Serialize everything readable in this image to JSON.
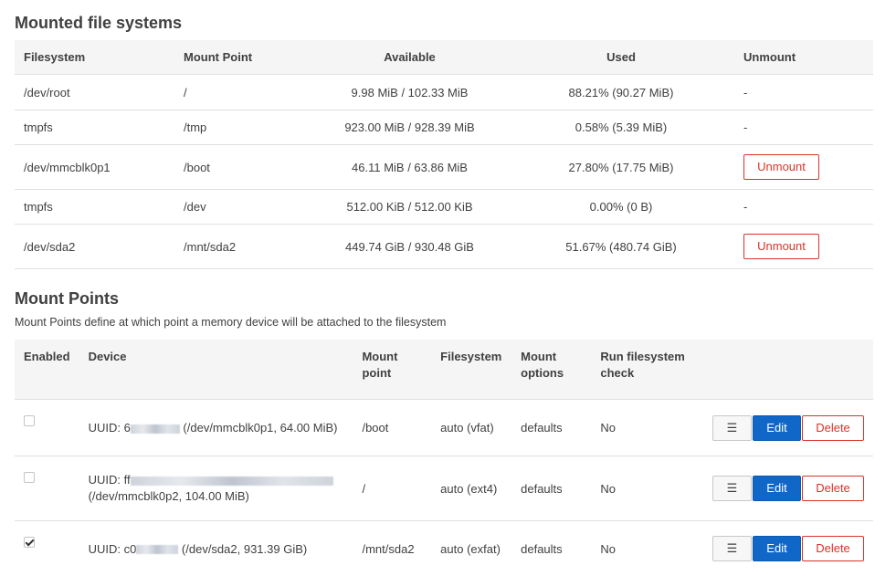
{
  "mounted": {
    "title": "Mounted file systems",
    "headers": {
      "filesystem": "Filesystem",
      "mount_point": "Mount Point",
      "available": "Available",
      "used": "Used",
      "unmount": "Unmount"
    },
    "rows": [
      {
        "fs": "/dev/root",
        "mp": "/",
        "avail": "9.98 MiB / 102.33 MiB",
        "used": "88.21% (90.27 MiB)",
        "action": "-"
      },
      {
        "fs": "tmpfs",
        "mp": "/tmp",
        "avail": "923.00 MiB / 928.39 MiB",
        "used": "0.58% (5.39 MiB)",
        "action": "-"
      },
      {
        "fs": "/dev/mmcblk0p1",
        "mp": "/boot",
        "avail": "46.11 MiB / 63.86 MiB",
        "used": "27.80% (17.75 MiB)",
        "action": "Unmount"
      },
      {
        "fs": "tmpfs",
        "mp": "/dev",
        "avail": "512.00 KiB / 512.00 KiB",
        "used": "0.00% (0 B)",
        "action": "-"
      },
      {
        "fs": "/dev/sda2",
        "mp": "/mnt/sda2",
        "avail": "449.74 GiB / 930.48 GiB",
        "used": "51.67% (480.74 GiB)",
        "action": "Unmount"
      }
    ]
  },
  "mount_points": {
    "title": "Mount Points",
    "description": "Mount Points define at which point a memory device will be attached to the filesystem",
    "headers": {
      "enabled": "Enabled",
      "device": "Device",
      "mount_point": "Mount point",
      "filesystem": "Filesystem",
      "mount_options": "Mount options",
      "fsck": "Run filesystem check"
    },
    "buttons": {
      "drag": "☰",
      "edit": "Edit",
      "delete": "Delete"
    },
    "rows": [
      {
        "enabled": false,
        "uuid_prefix": "UUID: 6",
        "device_suffix": " (/dev/mmcblk0p1, 64.00 MiB)",
        "mp": "/boot",
        "fs": "auto (vfat)",
        "opts": "defaults",
        "fsck": "No"
      },
      {
        "enabled": false,
        "uuid_prefix": "UUID: ff",
        "device_suffix": "(/dev/mmcblk0p2, 104.00 MiB)",
        "mp": "/",
        "fs": "auto (ext4)",
        "opts": "defaults",
        "fsck": "No"
      },
      {
        "enabled": true,
        "uuid_prefix": "UUID: c0",
        "device_suffix": " (/dev/sda2, 931.39 GiB)",
        "mp": "/mnt/sda2",
        "fs": "auto (exfat)",
        "opts": "defaults",
        "fsck": "No"
      }
    ]
  }
}
